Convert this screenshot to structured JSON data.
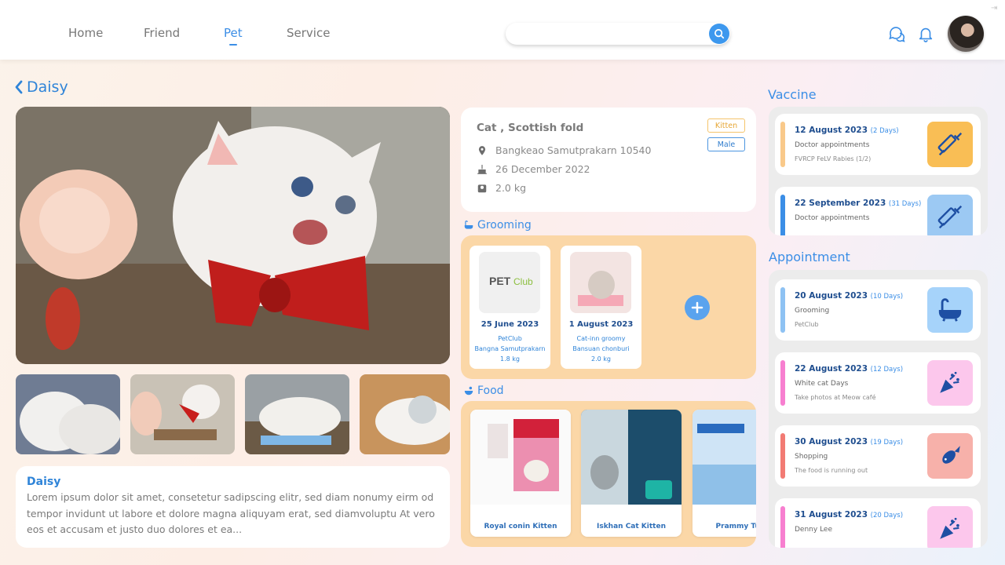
{
  "nav": {
    "links": [
      "Home",
      "Friend",
      "Pet",
      "Service"
    ],
    "active": "Pet",
    "search_placeholder": ""
  },
  "pet": {
    "name": "Daisy",
    "breed": "Cat , Scottish fold",
    "location": "Bangkeao Samutprakarn 10540",
    "birthday": "26 December 2022",
    "weight": "2.0 kg",
    "tags": [
      "Kitten",
      "Male"
    ],
    "description_title": "Daisy",
    "description": "Lorem ipsum dolor sit amet, consetetur sadipscing elitr, sed diam nonumy eirm od tempor invidunt ut labore et dolore magna aliquyam erat, sed diamvoluptu At vero eos et accusam et justo duo dolores et ea..."
  },
  "grooming": {
    "title": "Grooming",
    "items": [
      {
        "date": "25 June 2023",
        "place": "PetClub",
        "location": "Bangna Samutprakarn",
        "weight": "1.8 kg"
      },
      {
        "date": "1 August 2023",
        "place": "Cat-inn groomy",
        "location": "Bansuan chonburi",
        "weight": "2.0 kg"
      }
    ]
  },
  "food": {
    "title": "Food",
    "items": [
      {
        "name": "Royal conin Kitten"
      },
      {
        "name": "Iskhan Cat Kitten"
      },
      {
        "name": "Prammy Tuna"
      }
    ]
  },
  "vaccine": {
    "title": "Vaccine",
    "items": [
      {
        "date": "12 August 2023",
        "days": "(2 Days)",
        "title": "Doctor appointments",
        "sub": "FVRCP FeLV Rabies (1/2)",
        "bar": "#f9c98a",
        "icon_bg": "#f9be55",
        "icon": "syringe-icon"
      },
      {
        "date": "22 September 2023",
        "days": "(31 Days)",
        "title": "Doctor appointments",
        "sub": "",
        "bar": "#3b8ee6",
        "icon_bg": "#9cc9f3",
        "icon": "syringe-icon"
      }
    ]
  },
  "appointment": {
    "title": "Appointment",
    "items": [
      {
        "date": "20 August 2023",
        "days": "(10 Days)",
        "title": "Grooming",
        "sub": "PetClub",
        "bar": "#8ec2f3",
        "icon_bg": "#a6d3fa",
        "icon": "bathtub-icon"
      },
      {
        "date": "22 August 2023",
        "days": "(12 Days)",
        "title": "White cat Days",
        "sub": "Take photos at Meow café",
        "bar": "#f77fd0",
        "icon_bg": "#fcc7ec",
        "icon": "party-popper-icon"
      },
      {
        "date": "30 August 2023",
        "days": "(19 Days)",
        "title": "Shopping",
        "sub": "The food is running out",
        "bar": "#f27b74",
        "icon_bg": "#f7b1aa",
        "icon": "fish-icon"
      },
      {
        "date": "31 August 2023",
        "days": "(20 Days)",
        "title": "Denny Lee",
        "sub": "",
        "bar": "#f77fd0",
        "icon_bg": "#fcc7ec",
        "icon": "party-popper-icon"
      }
    ]
  }
}
